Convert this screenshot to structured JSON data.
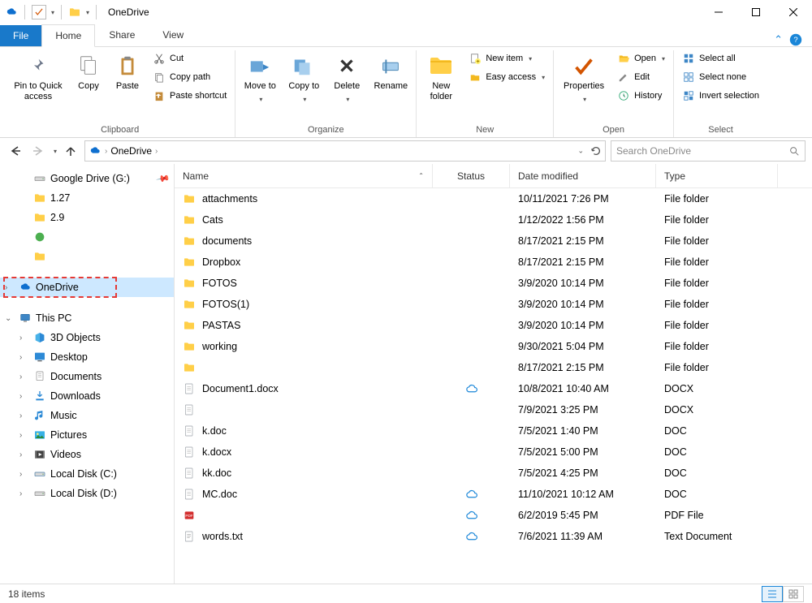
{
  "window": {
    "title": "OneDrive"
  },
  "tabs": {
    "file": "File",
    "home": "Home",
    "share": "Share",
    "view": "View"
  },
  "ribbon": {
    "clipboard": {
      "label": "Clipboard",
      "pin": "Pin to Quick access",
      "copy": "Copy",
      "paste": "Paste",
      "cut": "Cut",
      "copypath": "Copy path",
      "pasteshortcut": "Paste shortcut"
    },
    "organize": {
      "label": "Organize",
      "moveto": "Move to",
      "copyto": "Copy to",
      "delete": "Delete",
      "rename": "Rename"
    },
    "new": {
      "label": "New",
      "newfolder": "New folder",
      "newitem": "New item",
      "easyaccess": "Easy access"
    },
    "open": {
      "label": "Open",
      "properties": "Properties",
      "open": "Open",
      "edit": "Edit",
      "history": "History"
    },
    "select": {
      "label": "Select",
      "selectall": "Select all",
      "selectnone": "Select none",
      "invert": "Invert selection"
    }
  },
  "breadcrumb": {
    "root": "OneDrive"
  },
  "search": {
    "placeholder": "Search OneDrive"
  },
  "tree": [
    {
      "label": "Google Drive (G:)",
      "icon": "drive",
      "indent": 1,
      "pin": true
    },
    {
      "label": "1.27",
      "icon": "folder",
      "indent": 1
    },
    {
      "label": "2.9",
      "icon": "folder",
      "indent": 1
    },
    {
      "label": "",
      "icon": "green-dot",
      "indent": 1
    },
    {
      "label": "",
      "icon": "folder",
      "indent": 1
    },
    {
      "label": "OneDrive",
      "icon": "onedrive",
      "indent": 0,
      "exp": ">",
      "selected": true,
      "highlight": true
    },
    {
      "label": "This PC",
      "icon": "pc",
      "indent": 0,
      "exp": "v"
    },
    {
      "label": "3D Objects",
      "icon": "3d",
      "indent": 1,
      "exp": ">"
    },
    {
      "label": "Desktop",
      "icon": "desktop",
      "indent": 1,
      "exp": ">"
    },
    {
      "label": "Documents",
      "icon": "documents",
      "indent": 1,
      "exp": ">"
    },
    {
      "label": "Downloads",
      "icon": "downloads",
      "indent": 1,
      "exp": ">"
    },
    {
      "label": "Music",
      "icon": "music",
      "indent": 1,
      "exp": ">"
    },
    {
      "label": "Pictures",
      "icon": "pictures",
      "indent": 1,
      "exp": ">"
    },
    {
      "label": "Videos",
      "icon": "videos",
      "indent": 1,
      "exp": ">"
    },
    {
      "label": "Local Disk (C:)",
      "icon": "disk",
      "indent": 1,
      "exp": ">"
    },
    {
      "label": "Local Disk (D:)",
      "icon": "drive",
      "indent": 1,
      "exp": ">"
    }
  ],
  "columns": {
    "name": "Name",
    "status": "Status",
    "date": "Date modified",
    "type": "Type"
  },
  "files": [
    {
      "name": "attachments",
      "icon": "folder",
      "status": "",
      "date": "10/11/2021 7:26 PM",
      "type": "File folder"
    },
    {
      "name": "Cats",
      "icon": "folder",
      "status": "",
      "date": "1/12/2022 1:56 PM",
      "type": "File folder"
    },
    {
      "name": "documents",
      "icon": "folder",
      "status": "",
      "date": "8/17/2021 2:15 PM",
      "type": "File folder"
    },
    {
      "name": "Dropbox",
      "icon": "folder",
      "status": "",
      "date": "8/17/2021 2:15 PM",
      "type": "File folder"
    },
    {
      "name": "FOTOS",
      "icon": "folder",
      "status": "",
      "date": "3/9/2020 10:14 PM",
      "type": "File folder"
    },
    {
      "name": "FOTOS(1)",
      "icon": "folder",
      "status": "",
      "date": "3/9/2020 10:14 PM",
      "type": "File folder"
    },
    {
      "name": "PASTAS",
      "icon": "folder",
      "status": "",
      "date": "3/9/2020 10:14 PM",
      "type": "File folder"
    },
    {
      "name": "working",
      "icon": "folder",
      "status": "",
      "date": "9/30/2021 5:04 PM",
      "type": "File folder"
    },
    {
      "name": "",
      "icon": "folder",
      "status": "",
      "date": "8/17/2021 2:15 PM",
      "type": "File folder"
    },
    {
      "name": "Document1.docx",
      "icon": "doc",
      "status": "cloud",
      "date": "10/8/2021 10:40 AM",
      "type": "DOCX"
    },
    {
      "name": "",
      "icon": "doc",
      "status": "",
      "date": "7/9/2021 3:25 PM",
      "type": "DOCX"
    },
    {
      "name": "k.doc",
      "icon": "doc",
      "status": "",
      "date": "7/5/2021 1:40 PM",
      "type": "DOC"
    },
    {
      "name": "k.docx",
      "icon": "doc",
      "status": "",
      "date": "7/5/2021 5:00 PM",
      "type": "DOC"
    },
    {
      "name": "kk.doc",
      "icon": "doc",
      "status": "",
      "date": "7/5/2021 4:25 PM",
      "type": "DOC"
    },
    {
      "name": "MC.doc",
      "icon": "doc",
      "status": "cloud",
      "date": "11/10/2021 10:12 AM",
      "type": "DOC"
    },
    {
      "name": "",
      "icon": "pdf",
      "status": "cloud",
      "date": "6/2/2019 5:45 PM",
      "type": "PDF File"
    },
    {
      "name": "words.txt",
      "icon": "txt",
      "status": "cloud",
      "date": "7/6/2021 11:39 AM",
      "type": "Text Document"
    }
  ],
  "status": {
    "items": "18 items"
  }
}
